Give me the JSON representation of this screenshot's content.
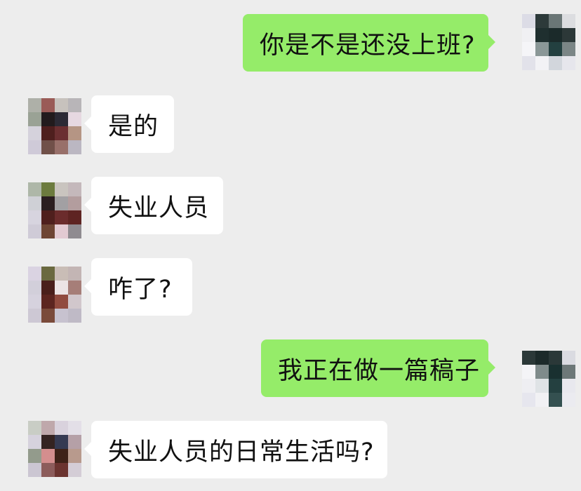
{
  "conversation": {
    "messages": [
      {
        "side": "out",
        "text": "你是不是还没上班?"
      },
      {
        "side": "in",
        "text": "是的"
      },
      {
        "side": "in",
        "text": "失业人员"
      },
      {
        "side": "in",
        "text": "咋了?"
      },
      {
        "side": "out",
        "text": "我正在做一篇稿子"
      },
      {
        "side": "in",
        "text": "失业人员的日常生活吗?"
      }
    ]
  },
  "colors": {
    "background": "#ededed",
    "incoming_bubble": "#ffffff",
    "outgoing_bubble": "#95ec69",
    "text": "#111111"
  },
  "avatars": {
    "self": "pixelated-avatar",
    "contact": "pixelated-avatar"
  }
}
